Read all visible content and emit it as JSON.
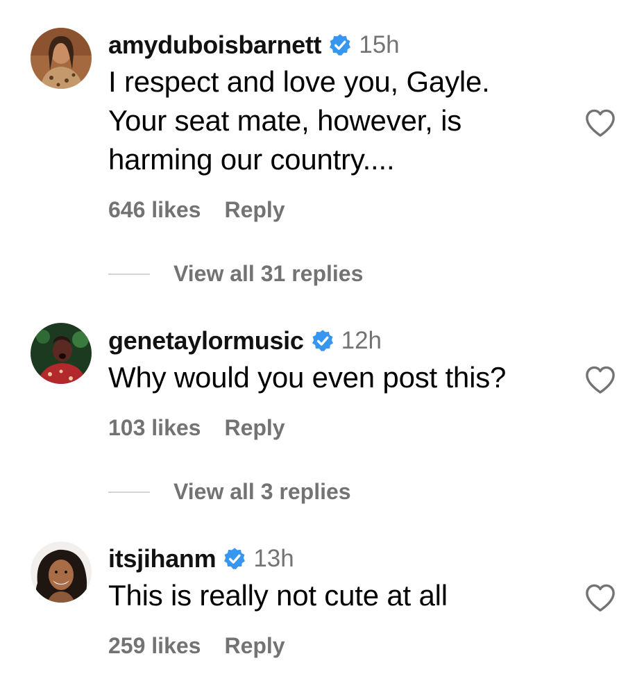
{
  "colors": {
    "verified_badge": "#3797f0",
    "secondary_text": "#737373",
    "divider": "#d4d4d4"
  },
  "comments": [
    {
      "username": "amyduboisbarnett",
      "verified": true,
      "time": "15h",
      "lines": [
        "I respect and love you, Gayle.",
        "Your seat mate, however, is",
        "harming our country...."
      ],
      "likes": "646 likes",
      "reply_label": "Reply",
      "view_replies": "View all 31 replies"
    },
    {
      "username": "genetaylormusic",
      "verified": true,
      "time": "12h",
      "lines": [
        "Why would you even post this?"
      ],
      "likes": "103 likes",
      "reply_label": "Reply",
      "view_replies": "View all 3 replies"
    },
    {
      "username": "itsjihanm",
      "verified": true,
      "time": "13h",
      "lines": [
        "This is really not cute at all"
      ],
      "likes": "259 likes",
      "reply_label": "Reply"
    }
  ]
}
